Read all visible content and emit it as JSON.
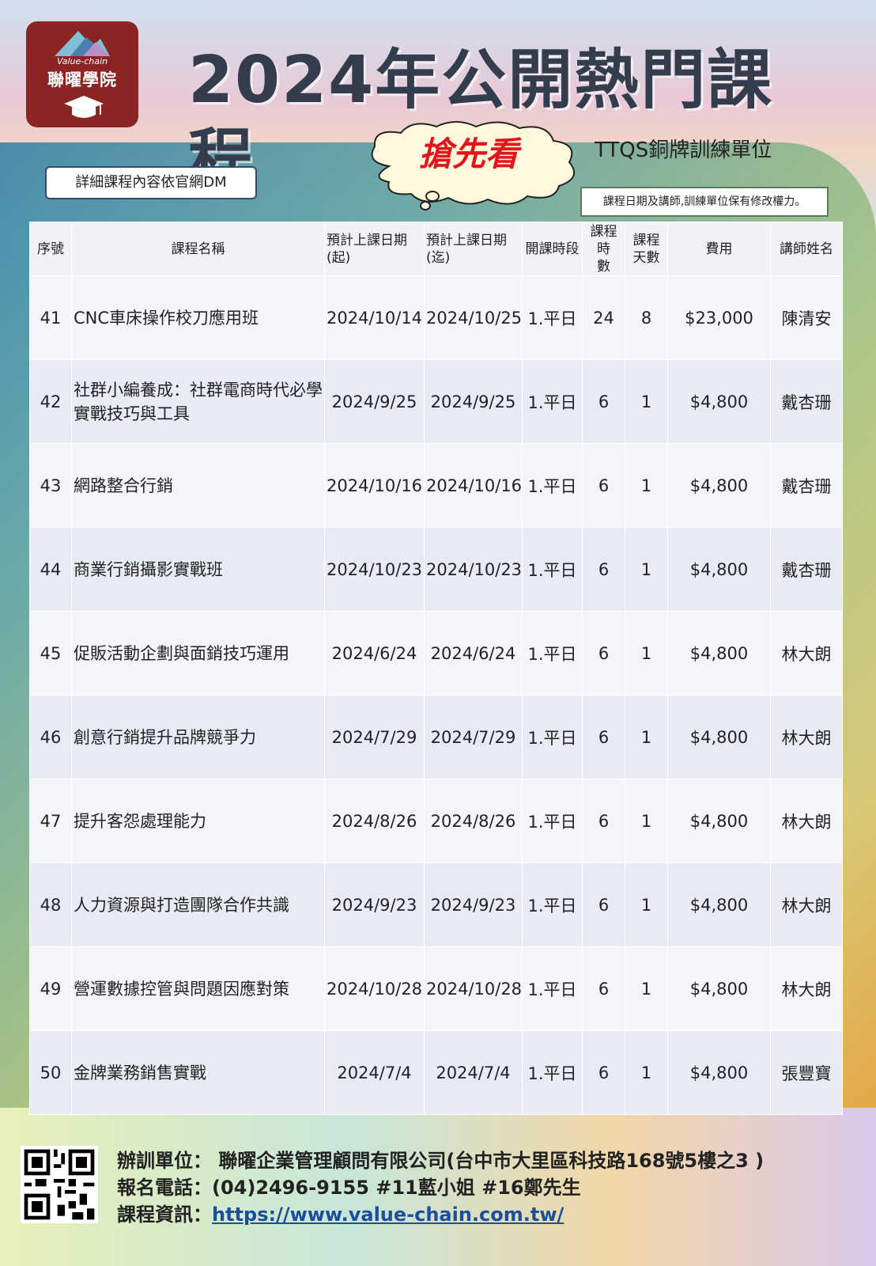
{
  "header": {
    "logo_en": "Value-chain",
    "logo_zh": "聯曜學院",
    "title": "2024年公開熱門課程",
    "cloud_text": "搶先看",
    "ttqs": "TTQS銅牌訓練單位",
    "dm_note": "詳細課程內容依官網DM",
    "rights_note": "課程日期及講師,訓練單位保有修改權力。"
  },
  "table": {
    "headers": {
      "no": "序號",
      "name": "課程名稱",
      "start_l1": "預計上課日期",
      "start_l2": "(起)",
      "end_l1": "預計上課日期",
      "end_l2": "(迄)",
      "slot": "開課時段",
      "hours_l1": "課程時",
      "hours_l2": "數",
      "days_l1": "課程",
      "days_l2": "天數",
      "fee": "費用",
      "teacher": "講師姓名"
    },
    "rows": [
      {
        "no": "41",
        "name": "CNC車床操作校刀應用班",
        "start": "2024/10/14",
        "end": "2024/10/25",
        "slot": "1.平日",
        "hours": "24",
        "days": "8",
        "fee": "$23,000",
        "teacher": "陳清安"
      },
      {
        "no": "42",
        "name": "社群小編養成：社群電商時代必學實戰技巧與工具",
        "start": "2024/9/25",
        "end": "2024/9/25",
        "slot": "1.平日",
        "hours": "6",
        "days": "1",
        "fee": "$4,800",
        "teacher": "戴杏珊"
      },
      {
        "no": "43",
        "name": "網路整合行銷",
        "start": "2024/10/16",
        "end": "2024/10/16",
        "slot": "1.平日",
        "hours": "6",
        "days": "1",
        "fee": "$4,800",
        "teacher": "戴杏珊"
      },
      {
        "no": "44",
        "name": "商業行銷攝影實戰班",
        "start": "2024/10/23",
        "end": "2024/10/23",
        "slot": "1.平日",
        "hours": "6",
        "days": "1",
        "fee": "$4,800",
        "teacher": "戴杏珊"
      },
      {
        "no": "45",
        "name": "促販活動企劃與面銷技巧運用",
        "start": "2024/6/24",
        "end": "2024/6/24",
        "slot": "1.平日",
        "hours": "6",
        "days": "1",
        "fee": "$4,800",
        "teacher": "林大朗"
      },
      {
        "no": "46",
        "name": "創意行銷提升品牌競爭力",
        "start": "2024/7/29",
        "end": "2024/7/29",
        "slot": "1.平日",
        "hours": "6",
        "days": "1",
        "fee": "$4,800",
        "teacher": "林大朗"
      },
      {
        "no": "47",
        "name": "提升客怨處理能力",
        "start": "2024/8/26",
        "end": "2024/8/26",
        "slot": "1.平日",
        "hours": "6",
        "days": "1",
        "fee": "$4,800",
        "teacher": "林大朗"
      },
      {
        "no": "48",
        "name": "人力資源與打造團隊合作共識",
        "start": "2024/9/23",
        "end": "2024/9/23",
        "slot": "1.平日",
        "hours": "6",
        "days": "1",
        "fee": "$4,800",
        "teacher": "林大朗"
      },
      {
        "no": "49",
        "name": "營運數據控管與問題因應對策",
        "start": "2024/10/28",
        "end": "2024/10/28",
        "slot": "1.平日",
        "hours": "6",
        "days": "1",
        "fee": "$4,800",
        "teacher": "林大朗"
      },
      {
        "no": "50",
        "name": "金牌業務銷售實戰",
        "start": "2024/7/4",
        "end": "2024/7/4",
        "slot": "1.平日",
        "hours": "6",
        "days": "1",
        "fee": "$4,800",
        "teacher": "張豐寶"
      }
    ]
  },
  "footer": {
    "organizer": "辦訓單位： 聯曜企業管理顧問有限公司(台中市大里區科技路168號5樓之3 )",
    "phone": "報名電話：(04)2496-9155 #11藍小姐 #16鄭先生",
    "info_label": "課程資訊：",
    "url": "https://www.value-chain.com.tw/"
  },
  "colors": {
    "logo_bg": "#8c2424",
    "title": "#333d4d",
    "cloud_text": "#e0161c",
    "link": "#1a4fa0"
  }
}
